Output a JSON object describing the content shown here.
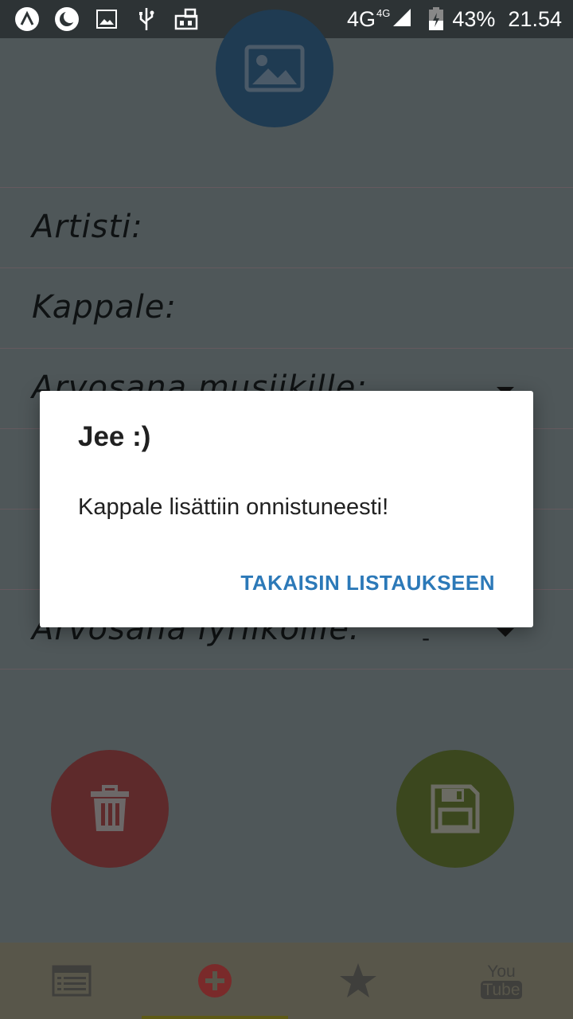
{
  "status_bar": {
    "network": "4G",
    "network_sup": "4G",
    "battery": "43%",
    "time": "21.54",
    "icons": [
      "app-icon",
      "moon-icon",
      "image-icon",
      "usb-icon",
      "sim-icon"
    ]
  },
  "form": {
    "fields": [
      {
        "label": "Artisti:",
        "value": ""
      },
      {
        "label": "Kappale:",
        "value": ""
      },
      {
        "label": "Arvosana musiikille:",
        "value": ""
      },
      {
        "label": "",
        "value": ""
      },
      {
        "label": "",
        "value": ""
      },
      {
        "label": "Arvosana lyriikoille:",
        "value": "-"
      }
    ]
  },
  "dialog": {
    "title": "Jee :)",
    "message": "Kappale lisättiin onnistuneesti!",
    "button": "TAKAISIN LISTAUKSEEN"
  },
  "colors": {
    "overlay": "#4f5759",
    "accent": "#2c79b8",
    "delete": "#5e2a2b",
    "save": "#3b471e",
    "nav_active": "#7a2a2a"
  },
  "bottom_nav": {
    "items": [
      "list-icon",
      "add-icon",
      "star-icon",
      "youtube-icon"
    ],
    "youtube_top": "You",
    "youtube_bottom": "Tube"
  }
}
